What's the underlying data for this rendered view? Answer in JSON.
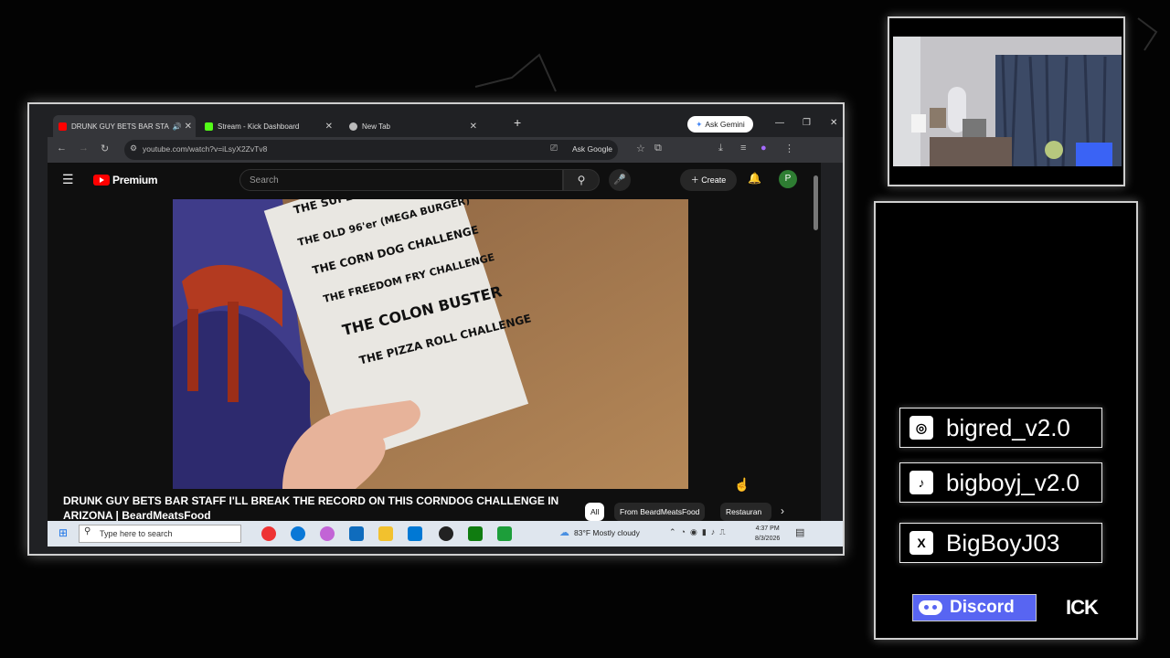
{
  "browser": {
    "tabs": [
      {
        "label": "DRUNK GUY BETS BAR STA",
        "icon": "youtube-icon",
        "color": "#ff0000",
        "active": true
      },
      {
        "label": "Stream - Kick Dashboard",
        "icon": "kick-icon",
        "color": "#53fc18",
        "active": false
      },
      {
        "label": "New Tab",
        "icon": "chrome-icon",
        "color": "#bbbbbb",
        "active": false
      }
    ],
    "new_tab": "+",
    "gemini_label": "Ask Gemini",
    "url": "youtube.com/watch?v=iLsyX2ZvTv8",
    "ask_google": "Ask Google"
  },
  "youtube": {
    "brand": "Premium",
    "search_placeholder": "Search",
    "create_label": "Create",
    "avatar_letter": "P",
    "video_title": "DRUNK GUY BETS BAR STAFF I'LL BREAK THE RECORD ON THIS CORNDOG CHALLENGE IN ARIZONA | BeardMeatsFood",
    "chips": [
      "All",
      "From BeardMeatsFood",
      "Restauran"
    ],
    "menu_lines": [
      "THE SUPER",
      "THE OLD 96'er (MEGA BURGER)",
      "THE CORN DOG CHALLENGE",
      "THE FREEDOM FRY CHALLENGE",
      "THE COLON BUSTER",
      "THE PIZZA ROLL CHALLENGE"
    ]
  },
  "taskbar": {
    "search_placeholder": "Type here to search",
    "weather": "83°F  Mostly cloudy",
    "time": "4:37 PM",
    "date": "8/3/2026"
  },
  "socials": [
    {
      "icon": "instagram-icon",
      "glyph": "◎",
      "handle": "bigred_v2.0"
    },
    {
      "icon": "tiktok-icon",
      "glyph": "♪",
      "handle": "bigboyj_v2.0"
    },
    {
      "icon": "x-icon",
      "glyph": "X",
      "handle": "BigBoyJ03"
    }
  ],
  "discord_label": "Discord",
  "kick_label": "ICK"
}
